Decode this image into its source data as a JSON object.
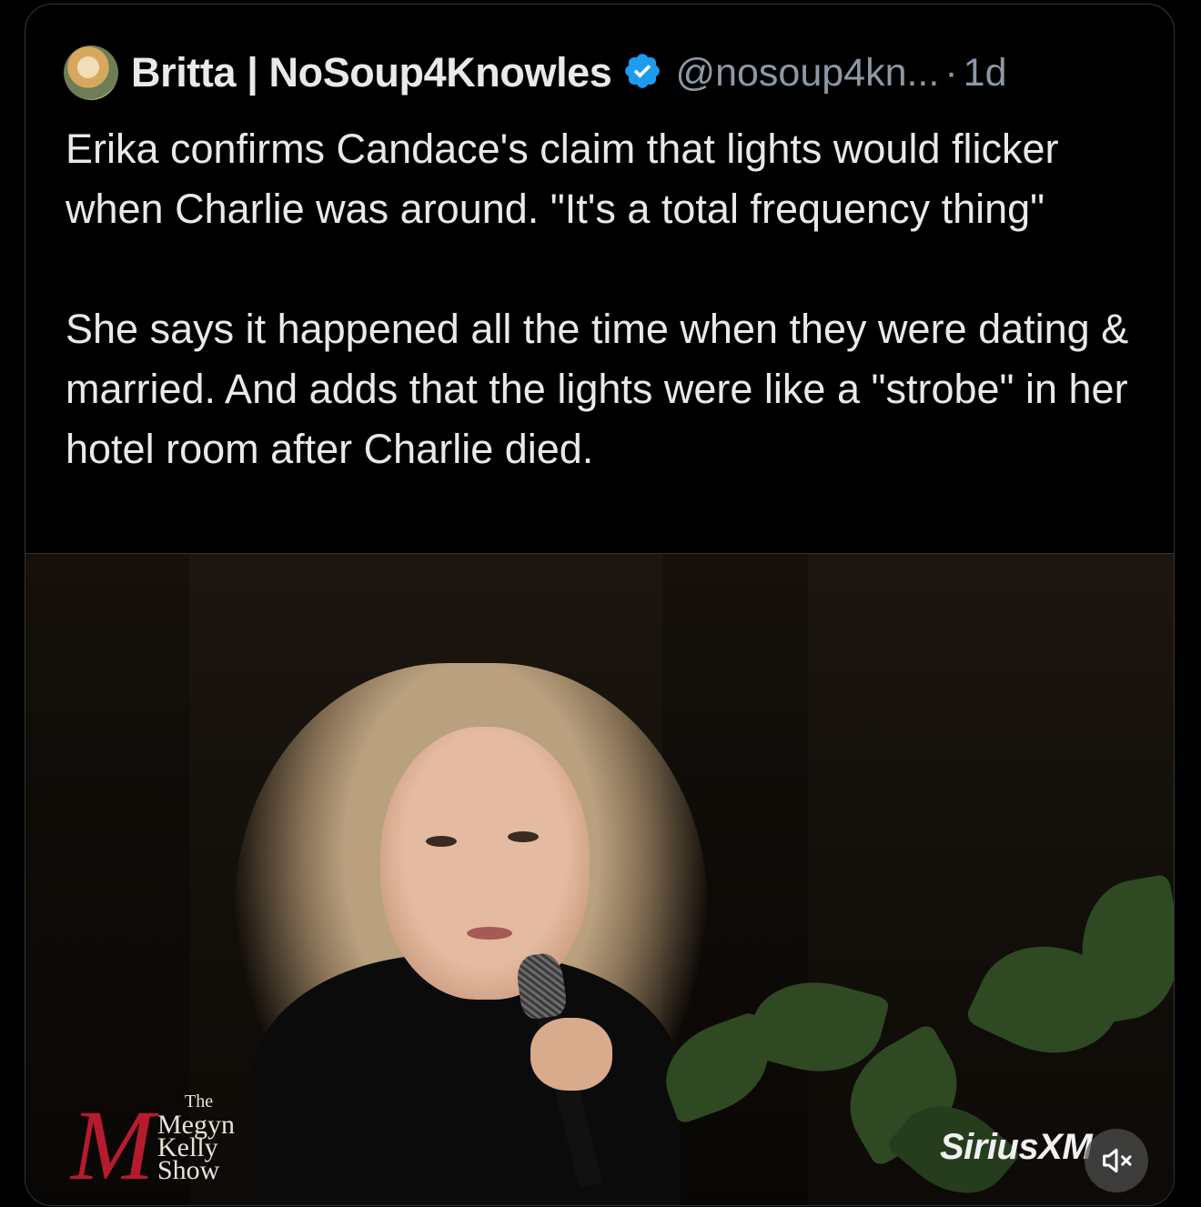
{
  "tweet": {
    "author_name": "Britta | NoSoup4Knowles",
    "handle": "@nosoup4kn...",
    "separator": "·",
    "time": "1d",
    "verified": true,
    "paragraphs": [
      "Erika confirms Candace's claim that lights would flicker when Charlie was around. \"It's a total frequency thing\"",
      "She says it happened all the time when they were dating & married. And adds that the lights were like a \"strobe\" in her hotel room after Charlie died."
    ]
  },
  "media": {
    "logo": {
      "the": "The",
      "line1": "Megyn",
      "line2": "Kelly",
      "line3": "Show",
      "monogram": "M"
    },
    "network_watermark": "SiriusXM",
    "mute_icon": "speaker-muted-icon"
  },
  "colors": {
    "background": "#000000",
    "text_primary": "#e7e9ea",
    "text_secondary": "#8b98a5",
    "verified_blue": "#1d9bf0",
    "border": "#333639"
  }
}
